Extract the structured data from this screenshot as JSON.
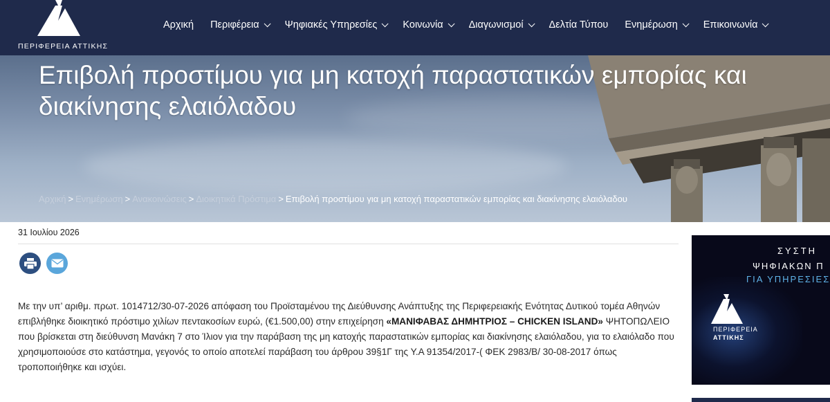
{
  "brand": {
    "logo_text": "ΠΕΡΙΦΕΡΕΙΑ ΑΤΤΙΚΗΣ",
    "primary_color": "#1f2a4b"
  },
  "nav": {
    "items": [
      {
        "label": "Αρχική",
        "has_dropdown": false
      },
      {
        "label": "Περιφέρεια",
        "has_dropdown": true
      },
      {
        "label": "Ψηφιακές Υπηρεσίες",
        "has_dropdown": true
      },
      {
        "label": "Κοινωνία",
        "has_dropdown": true
      },
      {
        "label": "Διαγωνισμοί",
        "has_dropdown": true
      },
      {
        "label": "Δελτία Τύπου",
        "has_dropdown": false
      },
      {
        "label": "Ενημέρωση",
        "has_dropdown": true
      },
      {
        "label": "Επικοινωνία",
        "has_dropdown": true
      }
    ]
  },
  "hero": {
    "title": "Επιβολή προστίμου για μη κατοχή παραστατικών εμπορίας και διακίνησης ελαιόλαδου"
  },
  "breadcrumb": {
    "items": [
      "Αρχική",
      "Ενημέρωση",
      "Ανακοινώσεις",
      "Διοικητικά Πρόστιμα"
    ],
    "separator": ">",
    "current": "Επιβολή προστίμου για μη κατοχή παραστατικών εμπορίας και διακίνησης ελαιόλαδου"
  },
  "article": {
    "date": "31 Ιουλίου 2026",
    "body_before": "Με την υπ’ αριθμ. πρωτ. 1014712/30-07-2026 απόφαση του Προϊσταμένου της Διεύθυνσης Ανάπτυξης της Περιφερειακής Ενότητας Δυτικού τομέα Αθηνών επιβλήθηκε διοικητικό πρόστιμο χιλίων πεντακοσίων ευρώ, (€1.500,00) στην επιχείρηση ",
    "body_bold": "«ΜΑΝΙΦΑΒΑΣ ΔΗΜΗΤΡΙΟΣ – CHICKEN ISLAND»",
    "body_after": " ΨΗΤΟΠΩΛΕΙΟ που βρίσκεται στη διεύθυνση Μανάκη 7 στο Ίλιον για την παράβαση της μη κατοχής παραστατικών εμπορίας και διακίνησης ελαιόλαδου, για το ελαιόλαδο που χρησιμοποιούσε στο κατάστημα, γεγονός το οποίο αποτελεί παράβαση του άρθρου 39§1Γ της Υ.Α 91354/2017-( ΦΕΚ 2983/Β/ 30-08-2017 όπως τροποποιήθηκε και ισχύει."
  },
  "share": {
    "print_icon": "printer-icon",
    "mail_icon": "envelope-icon",
    "print_color": "#2d4f80",
    "mail_color": "#5aa6db"
  },
  "banner": {
    "line1": "ΣΥΣΤΗ",
    "line2": "ΨΗΦΙΑΚΩΝ Π",
    "line3": "ΓΙΑ ΥΠΗΡΕΣΙΕΣ Π",
    "logo_line1": "ΠΕΡΙΦΕΡΕΙΑ",
    "logo_line2": "ΑΤΤΙΚΗΣ"
  }
}
